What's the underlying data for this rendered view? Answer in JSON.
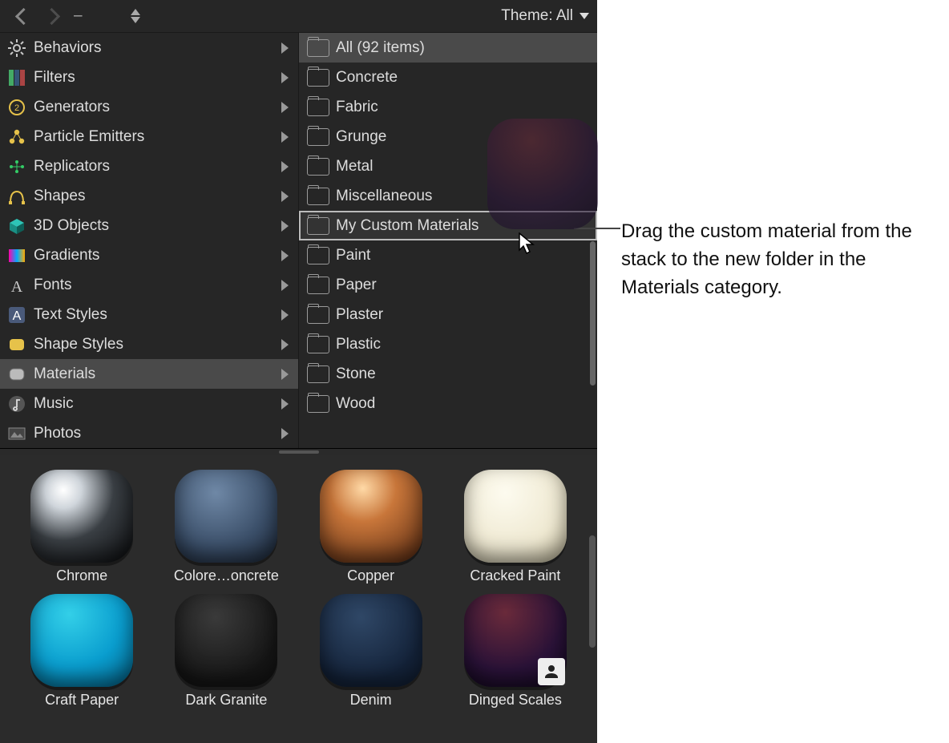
{
  "toolbar": {
    "theme_label": "Theme: All",
    "path_placeholder": "–"
  },
  "categories": [
    {
      "label": "Behaviors",
      "icon": "gear",
      "selected": false
    },
    {
      "label": "Filters",
      "icon": "filter",
      "selected": false
    },
    {
      "label": "Generators",
      "icon": "generator",
      "selected": false
    },
    {
      "label": "Particle Emitters",
      "icon": "particles",
      "selected": false
    },
    {
      "label": "Replicators",
      "icon": "replicator",
      "selected": false
    },
    {
      "label": "Shapes",
      "icon": "shape",
      "selected": false
    },
    {
      "label": "3D Objects",
      "icon": "cube3d",
      "selected": false
    },
    {
      "label": "Gradients",
      "icon": "gradient",
      "selected": false
    },
    {
      "label": "Fonts",
      "icon": "font",
      "selected": false
    },
    {
      "label": "Text Styles",
      "icon": "textstyle",
      "selected": false
    },
    {
      "label": "Shape Styles",
      "icon": "shapestyle",
      "selected": false
    },
    {
      "label": "Materials",
      "icon": "material",
      "selected": true
    },
    {
      "label": "Music",
      "icon": "music",
      "selected": false
    },
    {
      "label": "Photos",
      "icon": "photos",
      "selected": false
    }
  ],
  "folders": [
    {
      "label": "All (92 items)",
      "selected": true,
      "dragover": false
    },
    {
      "label": "Concrete",
      "selected": false,
      "dragover": false
    },
    {
      "label": "Fabric",
      "selected": false,
      "dragover": false
    },
    {
      "label": "Grunge",
      "selected": false,
      "dragover": false
    },
    {
      "label": "Metal",
      "selected": false,
      "dragover": false
    },
    {
      "label": "Miscellaneous",
      "selected": false,
      "dragover": false
    },
    {
      "label": "My Custom Materials",
      "selected": false,
      "dragover": true
    },
    {
      "label": "Paint",
      "selected": false,
      "dragover": false
    },
    {
      "label": "Paper",
      "selected": false,
      "dragover": false
    },
    {
      "label": "Plaster",
      "selected": false,
      "dragover": false
    },
    {
      "label": "Plastic",
      "selected": false,
      "dragover": false
    },
    {
      "label": "Stone",
      "selected": false,
      "dragover": false
    },
    {
      "label": "Wood",
      "selected": false,
      "dragover": false
    }
  ],
  "materials": [
    {
      "label": "Chrome",
      "style": "background:radial-gradient(circle at 32% 22%, #fff 0%, #cfd5db 18%, #3a3f44 50%, #0b0c0e 100%)",
      "user": false
    },
    {
      "label": "Colore…oncrete",
      "style": "background:radial-gradient(circle at 40% 25%, #6f88a6, #3a4e68 60%, #1f2b3c)",
      "user": false
    },
    {
      "label": "Copper",
      "style": "background:radial-gradient(circle at 42% 20%, #ffd9a6 0%, #c8763a 35%, #5a2b12 100%)",
      "user": false
    },
    {
      "label": "Cracked Paint",
      "style": "background:radial-gradient(circle at 40% 25%, #fdfbef, #efe9d2 60%, #cfc7a8)",
      "user": false
    },
    {
      "label": "Craft Paper",
      "style": "background:radial-gradient(circle at 38% 22%, #33cfe8, #0a9ecf 55%, #046a93)",
      "user": false
    },
    {
      "label": "Dark Granite",
      "style": "background:radial-gradient(circle at 40% 25%, #3a3a3a, #161616 70%)",
      "user": false
    },
    {
      "label": "Denim",
      "style": "background:radial-gradient(circle at 40% 25%, #2f4766, #14233a 70%)",
      "user": false
    },
    {
      "label": "Dinged Scales",
      "style": "background:radial-gradient(circle at 40% 20%, #6a2a3a, #2a1238 60%, #120820)",
      "user": true
    }
  ],
  "callout": "Drag the custom material from the stack to the new folder in the Materials category."
}
